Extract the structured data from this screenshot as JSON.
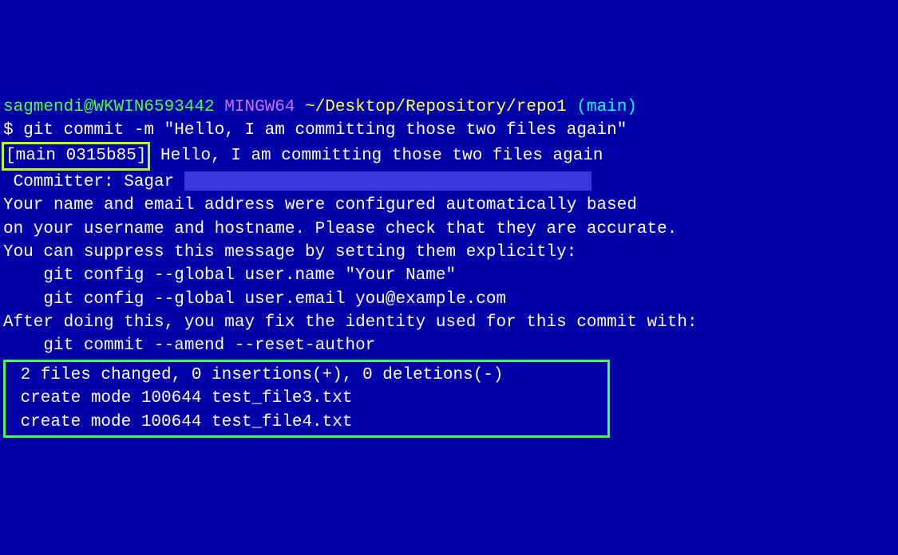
{
  "prompt": {
    "user_host": "sagmendi@WKWIN6593442",
    "env": "MINGW64",
    "path": "~/Desktop/Repository/repo1",
    "branch": "(main)",
    "symbol": "$",
    "command": "git commit -m \"Hello, I am committing those two files again\""
  },
  "output": {
    "commit_ref": "[main 0315b85]",
    "commit_msg": " Hello, I am committing those two files again",
    "committer_line": " Committer: Sagar ",
    "config_msg_1": "Your name and email address were configured automatically based",
    "config_msg_2": "on your username and hostname. Please check that they are accurate.",
    "config_msg_3": "You can suppress this message by setting them explicitly:",
    "blank_1": "",
    "config_cmd_1": "    git config --global user.name \"Your Name\"",
    "config_cmd_2": "    git config --global user.email you@example.com",
    "blank_2": "",
    "after_msg": "After doing this, you may fix the identity used for this commit with:",
    "blank_3": "",
    "amend_cmd": "    git commit --amend --reset-author",
    "blank_4": "",
    "summary_1": " 2 files changed, 0 insertions(+), 0 deletions(-)",
    "summary_2": " create mode 100644 test_file3.txt",
    "summary_3": " create mode 100644 test_file4.txt"
  }
}
